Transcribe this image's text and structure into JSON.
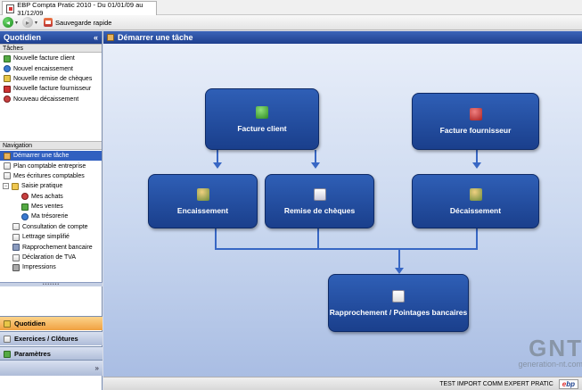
{
  "window": {
    "title": "EBP Compta Pratic 2010 - Du 01/01/09 au 31/12/09"
  },
  "toolbar": {
    "save_label": "Sauvegarde rapide"
  },
  "left_panel": {
    "title": "Quotidien",
    "tasks_title": "Tâches",
    "tasks": [
      {
        "label": "Nouvelle facture client",
        "icon": "invoice-client-icon"
      },
      {
        "label": "Nouvel encaissement",
        "icon": "receipt-icon"
      },
      {
        "label": "Nouvelle remise de chèques",
        "icon": "cheque-icon"
      },
      {
        "label": "Nouvelle facture fournisseur",
        "icon": "invoice-supplier-icon"
      },
      {
        "label": "Nouveau décaissement",
        "icon": "payment-icon"
      }
    ],
    "nav_title": "Navigation",
    "nav": [
      {
        "label": "Démarrer une tâche"
      },
      {
        "label": "Plan comptable entreprise"
      },
      {
        "label": "Mes écritures comptables"
      },
      {
        "label": "Saisie pratique"
      },
      {
        "label": "Mes achats"
      },
      {
        "label": "Mes ventes"
      },
      {
        "label": "Ma trésorerie"
      },
      {
        "label": "Consultation de compte"
      },
      {
        "label": "Lettrage simplifié"
      },
      {
        "label": "Rapprochement bancaire"
      },
      {
        "label": "Déclaration de TVA"
      },
      {
        "label": "Impressions"
      }
    ],
    "bottom_tabs": [
      {
        "label": "Quotidien"
      },
      {
        "label": "Exercices / Clôtures"
      },
      {
        "label": "Paramètres"
      }
    ],
    "expand_symbol": "»"
  },
  "main": {
    "title": "Démarrer une tâche",
    "boxes": {
      "facture_client": "Facture client",
      "facture_fournisseur": "Facture fournisseur",
      "encaissement": "Encaissement",
      "remise_cheques": "Remise de chèques",
      "decaissement": "Décaissement",
      "rapprochement": "Rapprochement / Pointages bancaires"
    }
  },
  "watermark": {
    "big": "GNT",
    "small": "generation-nt.com"
  },
  "status": {
    "text": "TEST IMPORT COMM EXPERT PRATIC",
    "logo_main": "e",
    "logo_rest": "bp"
  }
}
